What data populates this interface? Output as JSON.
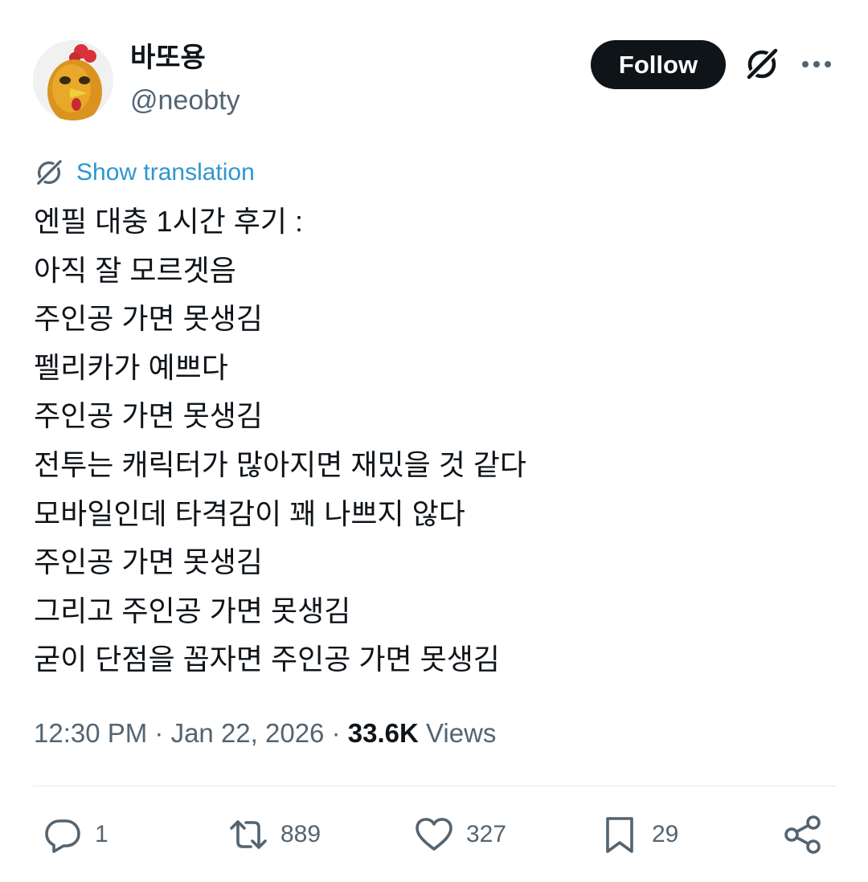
{
  "author": {
    "display_name": "바또용",
    "handle": "@neobty",
    "avatar_icon": "chicken-avatar"
  },
  "header_actions": {
    "follow_label": "Follow",
    "grok_icon": "grok-icon",
    "more_icon": "more-icon"
  },
  "translation": {
    "label": "Show translation",
    "icon": "grok-icon"
  },
  "tweet_lines": [
    "엔필 대충 1시간 후기 :",
    "아직 잘 모르겟음",
    "주인공 가면 못생김",
    "펠리카가 예쁘다",
    "주인공 가면 못생김",
    "전투는 캐릭터가 많아지면 재밌을 것 같다",
    "모바일인데 타격감이 꽤 나쁘지 않다",
    "주인공 가면 못생김",
    "그리고 주인공 가면 못생김",
    "굳이 단점을 꼽자면 주인공 가면 못생김"
  ],
  "meta": {
    "time": "12:30 PM",
    "separator": " · ",
    "date": "Jan 22, 2026",
    "views_count": "33.6K",
    "views_label": "Views"
  },
  "actions": {
    "replies": "1",
    "reposts": "889",
    "likes": "327",
    "bookmarks": "29"
  },
  "colors": {
    "text": "#0f1419",
    "secondary": "#536471",
    "link": "#2e96cf",
    "follow_bg": "#0f1419",
    "divider": "#e6e9eb"
  }
}
